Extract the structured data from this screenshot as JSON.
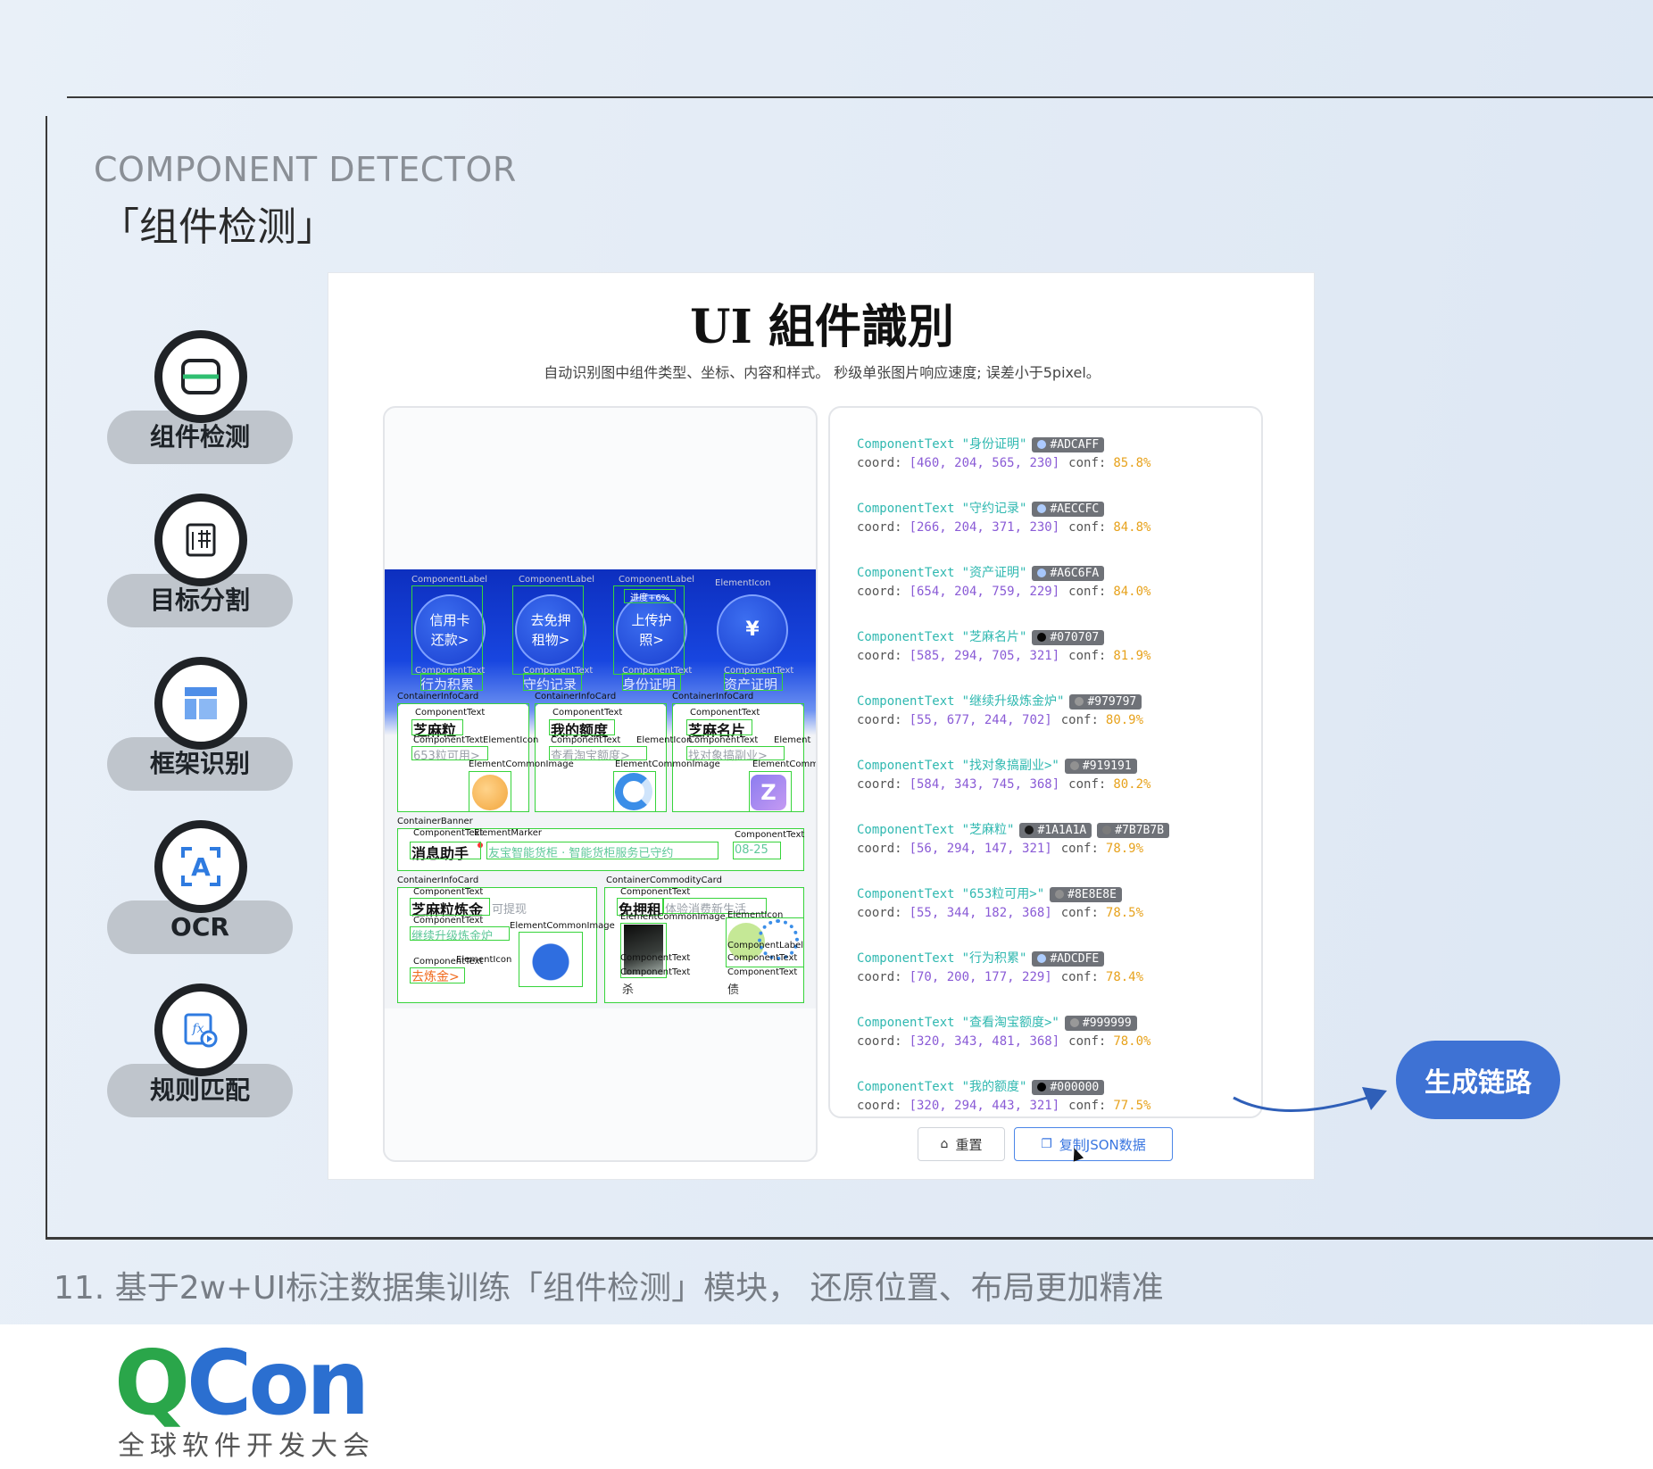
{
  "slide": {
    "kicker": "COMPONENT DETECTOR",
    "title": "「组件检测」",
    "caption": "11. 基于2w+UI标注数据集训练「组件检测」模块， 还原位置、布局更加精准",
    "generate_label": "生成链路"
  },
  "nav": [
    {
      "label": "组件检测",
      "icon": "component-detect-icon"
    },
    {
      "label": "目标分割",
      "icon": "segmentation-icon"
    },
    {
      "label": "框架识别",
      "icon": "layout-icon"
    },
    {
      "label": "OCR",
      "icon": "ocr-icon"
    },
    {
      "label": "规则匹配",
      "icon": "rule-match-icon"
    }
  ],
  "panel": {
    "title": "UI 組件識別",
    "subtitle": "自动识别图中组件类型、坐标、内容和样式。 秒级单张图片响应速度; 误差小于5pixel。",
    "reset_label": "重置",
    "copy_label": "复制JSON数据"
  },
  "app": {
    "circles": [
      {
        "text1": "信用卡",
        "text2": "还款>",
        "label": "行为积累"
      },
      {
        "text1": "去免押",
        "text2": "租物>",
        "label": "守约记录"
      },
      {
        "text1": "上传护",
        "text2": "照>",
        "label": "身份证明"
      },
      {
        "text1": "¥",
        "text2": "",
        "label": "资产证明"
      }
    ],
    "ann_labels": {
      "container_info": "ContainerInfoCard",
      "component_text": "ComponentText",
      "element_icon": "ElementIcon",
      "element_image": "ElementCommonImage",
      "container_banner": "ContainerBanner",
      "container_commodity": "ContainerCommodityCard",
      "element_marker": "ElementMarker",
      "component_label": "ComponentLabel",
      "element_comm": "ElementComm",
      "element": "Element",
      "badge": "进度+6%"
    },
    "cards": [
      {
        "title": "芝麻粒",
        "sub": "653粒可用>"
      },
      {
        "title": "我的额度",
        "sub": "查看淘宝额度>"
      },
      {
        "title": "芝麻名片",
        "sub": "找对象搞副业>"
      }
    ],
    "banner": {
      "title": "消息助手",
      "sub": "友宝智能货柜 · 智能货柜服务已守约",
      "date": "08-25"
    },
    "bottom_left": {
      "title": "芝麻粒炼金",
      "tag": "可提现",
      "sub": "继续升级炼金炉",
      "action": "去炼金>"
    },
    "bottom_right": {
      "title": "免押租",
      "sub": "体验消费新生活"
    },
    "bottom_right_labels": {
      "flash": "杀",
      "credit": "债"
    }
  },
  "results": [
    {
      "name": "\"身份证明\"",
      "colors": [
        {
          "hex": "#ADCAFF",
          "dot": "#ADCAFF"
        }
      ],
      "coord": "[460, 204, 565, 230]",
      "conf": "85.8%"
    },
    {
      "name": "\"守约记录\"",
      "colors": [
        {
          "hex": "#AECCFC",
          "dot": "#AECCFC"
        }
      ],
      "coord": "[266, 204, 371, 230]",
      "conf": "84.8%"
    },
    {
      "name": "\"资产证明\"",
      "colors": [
        {
          "hex": "#A6C6FA",
          "dot": "#A6C6FA"
        }
      ],
      "coord": "[654, 204, 759, 229]",
      "conf": "84.0%"
    },
    {
      "name": "\"芝麻名片\"",
      "colors": [
        {
          "hex": "#070707",
          "dot": "#070707"
        }
      ],
      "coord": "[585, 294, 705, 321]",
      "conf": "81.9%"
    },
    {
      "name": "\"继续升级炼金炉\"",
      "colors": [
        {
          "hex": "#979797",
          "dot": "#979797"
        }
      ],
      "coord": "[55, 677, 244, 702]",
      "conf": "80.9%"
    },
    {
      "name": "\"找对象搞副业>\"",
      "colors": [
        {
          "hex": "#919191",
          "dot": "#919191"
        }
      ],
      "coord": "[584, 343, 745, 368]",
      "conf": "80.2%"
    },
    {
      "name": "\"芝麻粒\"",
      "colors": [
        {
          "hex": "#1A1A1A",
          "dot": "#1A1A1A"
        },
        {
          "hex": "#7B7B7B",
          "dot": "#7B7B7B"
        }
      ],
      "coord": "[56, 294, 147, 321]",
      "conf": "78.9%"
    },
    {
      "name": "\"653粒可用>\"",
      "colors": [
        {
          "hex": "#8E8E8E",
          "dot": "#8E8E8E"
        }
      ],
      "coord": "[55, 344, 182, 368]",
      "conf": "78.5%"
    },
    {
      "name": "\"行为积累\"",
      "colors": [
        {
          "hex": "#ADCDFE",
          "dot": "#ADCDFE"
        }
      ],
      "coord": "[70, 200, 177, 229]",
      "conf": "78.4%"
    },
    {
      "name": "\"查看淘宝额度>\"",
      "colors": [
        {
          "hex": "#999999",
          "dot": "#999999"
        }
      ],
      "coord": "[320, 343, 481, 368]",
      "conf": "78.0%"
    },
    {
      "name": "\"我的额度\"",
      "colors": [
        {
          "hex": "#000000",
          "dot": "#000000"
        }
      ],
      "coord": "[320, 294, 443, 321]",
      "conf": "77.5%"
    }
  ],
  "result_prefix": "ComponentText",
  "coord_label": "coord:",
  "conf_label": "conf:",
  "logo": {
    "q": "Q",
    "con": "Con",
    "sub": "全球软件开发大会"
  }
}
